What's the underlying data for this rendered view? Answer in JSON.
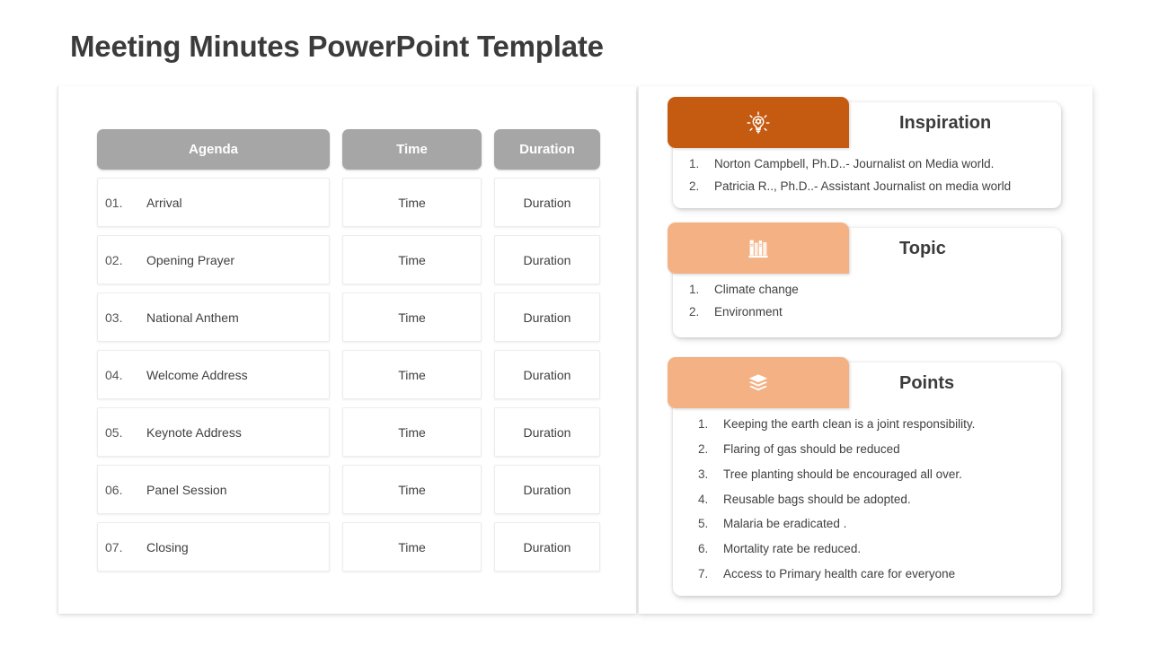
{
  "title": "Meeting Minutes PowerPoint Template",
  "colors": {
    "header_gray": "#A6A6A6",
    "accent_dark_orange": "#C55A11",
    "accent_light_orange": "#F4B183",
    "title_text": "#3B3B3B"
  },
  "agenda_table": {
    "headers": {
      "agenda": "Agenda",
      "time": "Time",
      "duration": "Duration"
    },
    "rows": [
      {
        "num": "01.",
        "agenda": "Arrival",
        "time": "Time",
        "duration": "Duration"
      },
      {
        "num": "02.",
        "agenda": "Opening Prayer",
        "time": "Time",
        "duration": "Duration"
      },
      {
        "num": "03.",
        "agenda": "National Anthem",
        "time": "Time",
        "duration": "Duration"
      },
      {
        "num": "04.",
        "agenda": "Welcome Address",
        "time": "Time",
        "duration": "Duration"
      },
      {
        "num": "05.",
        "agenda": "Keynote Address",
        "time": "Time",
        "duration": "Duration"
      },
      {
        "num": "06.",
        "agenda": "Panel Session",
        "time": "Time",
        "duration": "Duration"
      },
      {
        "num": "07.",
        "agenda": "Closing",
        "time": "Time",
        "duration": "Duration"
      }
    ]
  },
  "cards": [
    {
      "key": "inspiration",
      "title": "Inspiration",
      "icon": "lightbulb-idea-icon",
      "header_color": "#C55A11",
      "items": [
        {
          "num": "1.",
          "text": "Norton Campbell, Ph.D..- Journalist on Media world."
        },
        {
          "num": "2.",
          "text": "Patricia R.., Ph.D..- Assistant Journalist on media world"
        }
      ]
    },
    {
      "key": "topic",
      "title": "Topic",
      "icon": "books-shelf-icon",
      "header_color": "#F4B183",
      "items": [
        {
          "num": "1.",
          "text": "Climate change"
        },
        {
          "num": "2.",
          "text": "Environment"
        }
      ]
    },
    {
      "key": "points",
      "title": "Points",
      "icon": "stacked-layers-icon",
      "header_color": "#F4B183",
      "items": [
        {
          "num": "1.",
          "text": "Keeping the earth clean is a joint responsibility."
        },
        {
          "num": "2.",
          "text": "Flaring of gas should be reduced"
        },
        {
          "num": "3.",
          "text": "Tree planting should be encouraged all over."
        },
        {
          "num": "4.",
          "text": "Reusable bags should be adopted."
        },
        {
          "num": "5.",
          "text": "Malaria be eradicated ."
        },
        {
          "num": "6.",
          "text": "Mortality rate be reduced."
        },
        {
          "num": "7.",
          "text": "Access to Primary health care for everyone"
        }
      ]
    }
  ]
}
